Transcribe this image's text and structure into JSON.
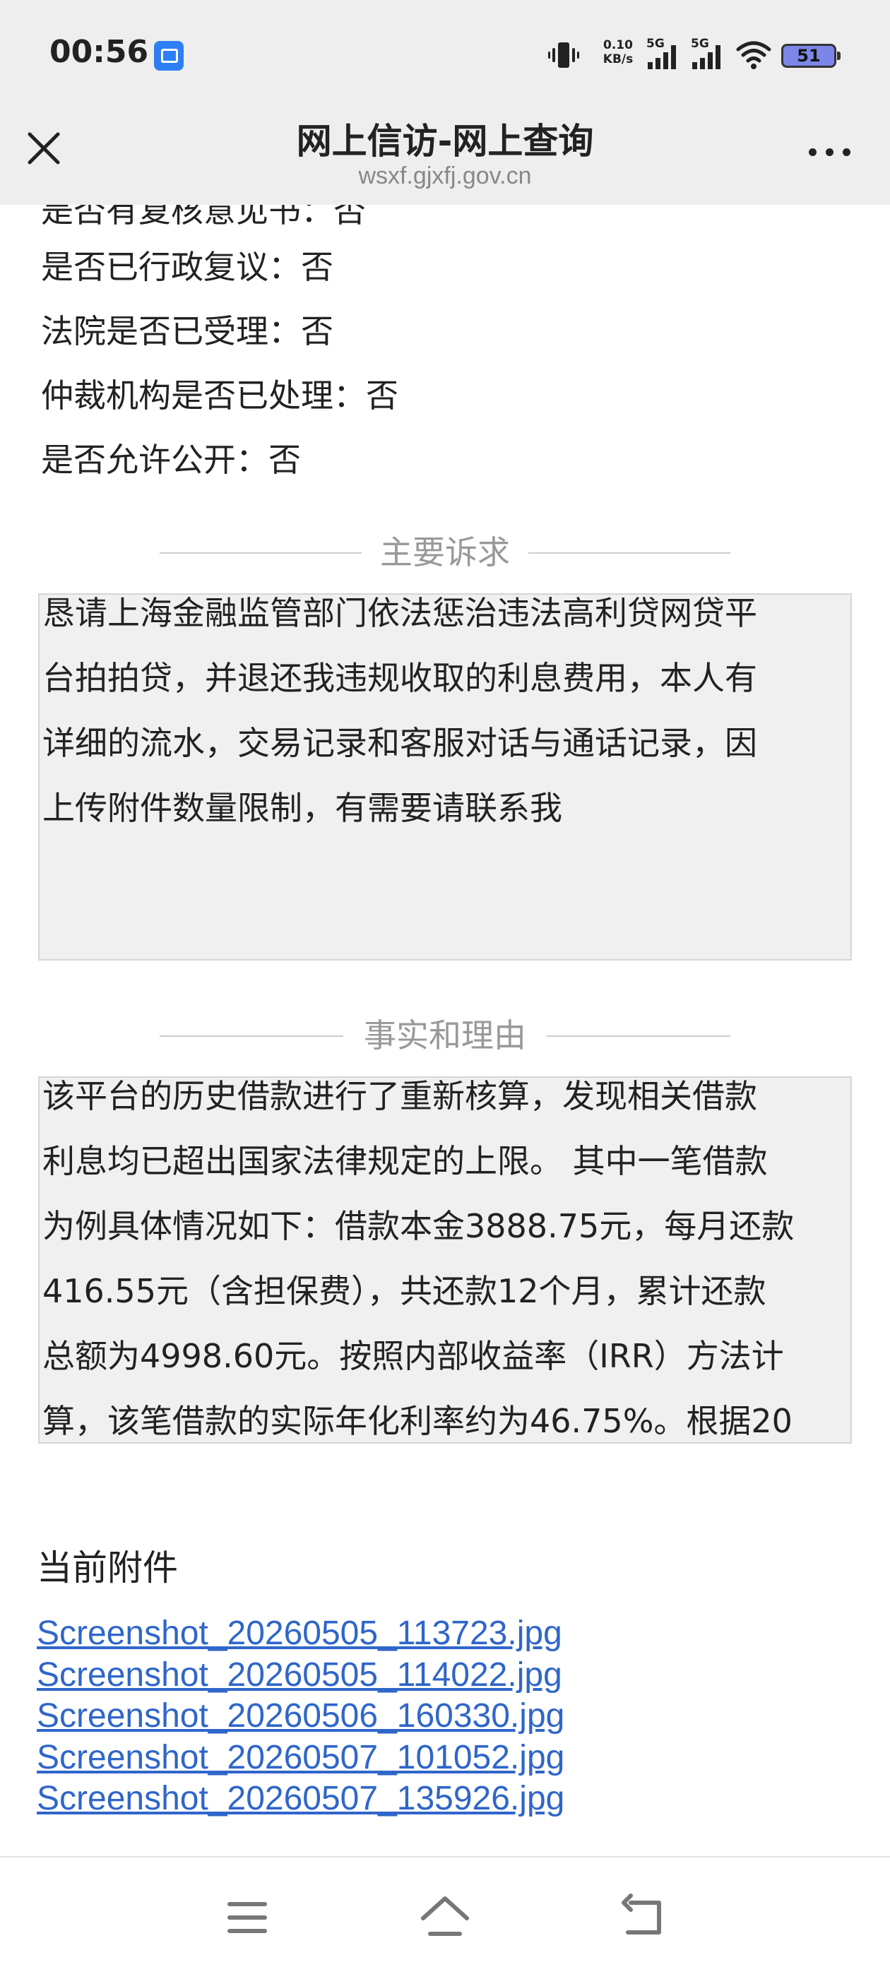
{
  "status_bar": {
    "time": "00:56",
    "app_icon": "scissors-app-icon",
    "net_speed_value": "0.10",
    "net_speed_unit": "KB/s",
    "signal1_label": "5G",
    "signal2_label": "5G",
    "battery_level": "51"
  },
  "title_bar": {
    "title": "网上信访-网上查询",
    "url": "wsxf.gjxfj.gov.cn",
    "close_icon": "close-icon",
    "more_icon": "more-icon"
  },
  "fields": [
    {
      "label": "是否有复核意见书：",
      "value": "否"
    },
    {
      "label": "是否已行政复议：",
      "value": "否"
    },
    {
      "label": "法院是否已受理：",
      "value": "否"
    },
    {
      "label": "仲裁机构是否已处理：",
      "value": "否"
    },
    {
      "label": "是否允许公开：",
      "value": "否"
    }
  ],
  "claims": {
    "title": "主要诉求",
    "lines": [
      "恳请上海金融监管部门依法惩治违法高利贷网贷平",
      "台拍拍贷，并退还我违规收取的利息费用，本人有",
      "详细的流水，交易记录和客服对话与通话记录，因",
      "上传附件数量限制，有需要请联系我"
    ]
  },
  "facts": {
    "title": "事实和理由",
    "lines": [
      "该平台的历史借款进行了重新核算，发现相关借款",
      "利息均已超出国家法律规定的上限。 其中一笔借款",
      "为例具体情况如下：借款本金3888.75元，每月还款",
      "416.55元（含担保费），共还款12个月，累计还款",
      "总额为4998.60元。按照内部收益率（IRR）方法计",
      "算，该笔借款的实际年化利率约为46.75%。根据20"
    ]
  },
  "attachments": {
    "heading": "当前附件",
    "files": [
      "Screenshot_20260505_113723.jpg",
      "Screenshot_20260505_114022.jpg",
      "Screenshot_20260506_160330.jpg",
      "Screenshot_20260507_101052.jpg",
      "Screenshot_20260507_135926.jpg"
    ]
  },
  "bottom_nav": {
    "menu_icon": "menu-icon",
    "home_icon": "home-icon",
    "back_icon": "back-icon"
  },
  "colors": {
    "link": "#2f66c9",
    "textbox_bg": "#f0f0f0",
    "section_title": "#999999",
    "topbar_bg": "#eeeeee"
  }
}
